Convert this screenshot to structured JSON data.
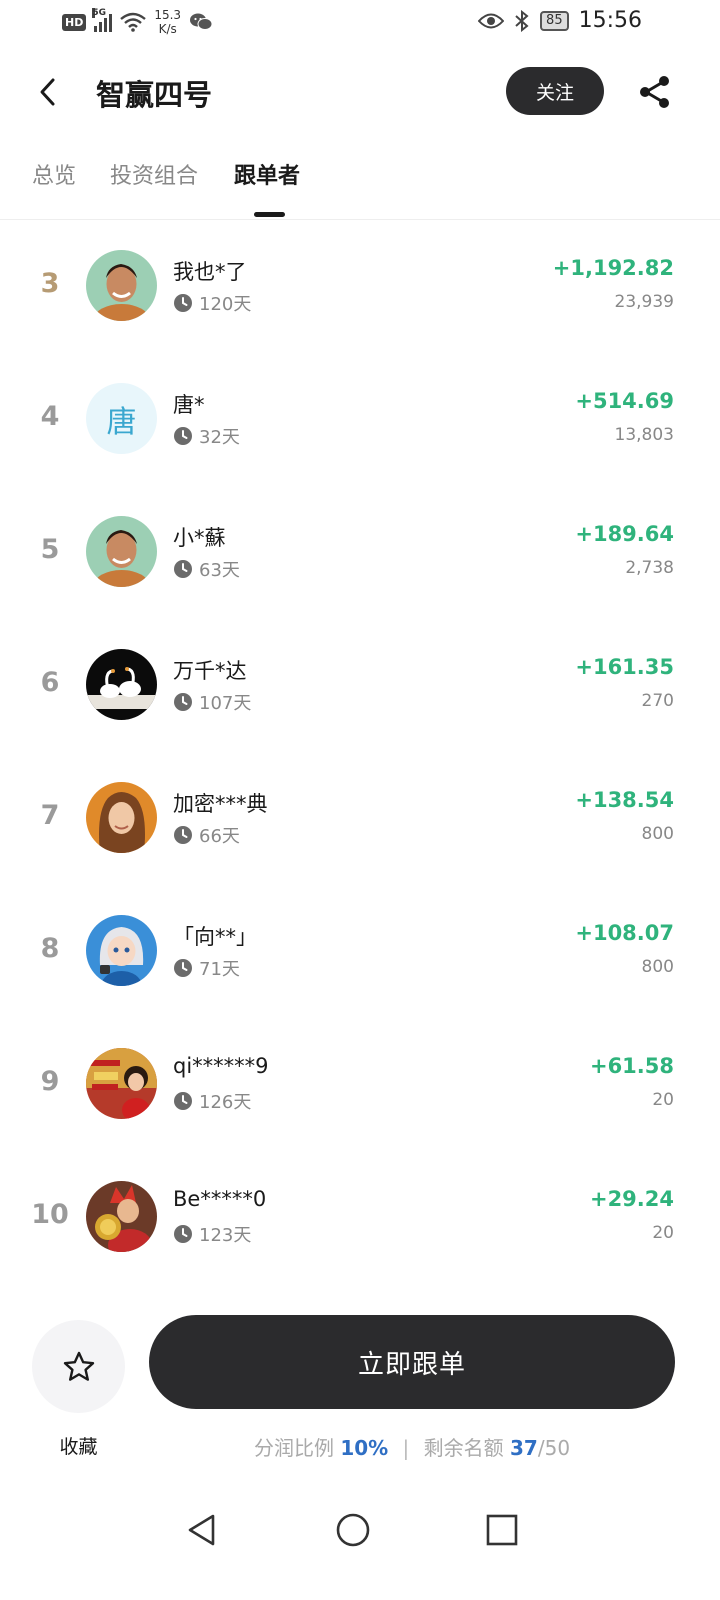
{
  "status_bar": {
    "hd": "HD",
    "network": "5G",
    "speed_value": "15.3",
    "speed_unit": "K/s",
    "battery": "85",
    "time": "15:56"
  },
  "header": {
    "title": "智赢四号",
    "follow_label": "关注"
  },
  "tabs": [
    {
      "label": "总览",
      "active": false
    },
    {
      "label": "投资组合",
      "active": false
    },
    {
      "label": "跟单者",
      "active": true
    }
  ],
  "followers": [
    {
      "rank": "3",
      "name": "我也*了",
      "days": "120天",
      "profit": "+1,192.82",
      "amount": "23,939",
      "avatar": "man-photo"
    },
    {
      "rank": "4",
      "name": "唐*",
      "days": "32天",
      "profit": "+514.69",
      "amount": "13,803",
      "avatar": "text",
      "avatar_text": "唐"
    },
    {
      "rank": "5",
      "name": "小*蘇",
      "days": "63天",
      "profit": "+189.64",
      "amount": "2,738",
      "avatar": "man-photo"
    },
    {
      "rank": "6",
      "name": "万千*达",
      "days": "107天",
      "profit": "+161.35",
      "amount": "270",
      "avatar": "swans-photo"
    },
    {
      "rank": "7",
      "name": "加密***典",
      "days": "66天",
      "profit": "+138.54",
      "amount": "800",
      "avatar": "woman-photo"
    },
    {
      "rank": "8",
      "name": "「向**」",
      "days": "71天",
      "profit": "+108.07",
      "amount": "800",
      "avatar": "anime-girl"
    },
    {
      "rank": "9",
      "name": "qi******9",
      "days": "126天",
      "profit": "+61.58",
      "amount": "20",
      "avatar": "poster-2025"
    },
    {
      "rank": "10",
      "name": "Be*****0",
      "days": "123天",
      "profit": "+29.24",
      "amount": "20",
      "avatar": "anime-coin"
    }
  ],
  "bottom": {
    "favorite_label": "收藏",
    "copy_button": "立即跟单",
    "profit_share_label": "分润比例",
    "profit_share_value": "10%",
    "separator": "|",
    "remaining_label": "剩余名额",
    "remaining_value": "37",
    "remaining_total": "/50"
  },
  "colors": {
    "profit_green": "#2fb37c",
    "dark_button": "#2b2b2d",
    "highlight_blue": "#2f6fc4",
    "rank_gold": "#b69b74"
  },
  "icons": [
    "back-arrow-icon",
    "share-icon",
    "clock-icon",
    "star-icon",
    "nav-back-icon",
    "nav-home-icon",
    "nav-recent-icon"
  ]
}
